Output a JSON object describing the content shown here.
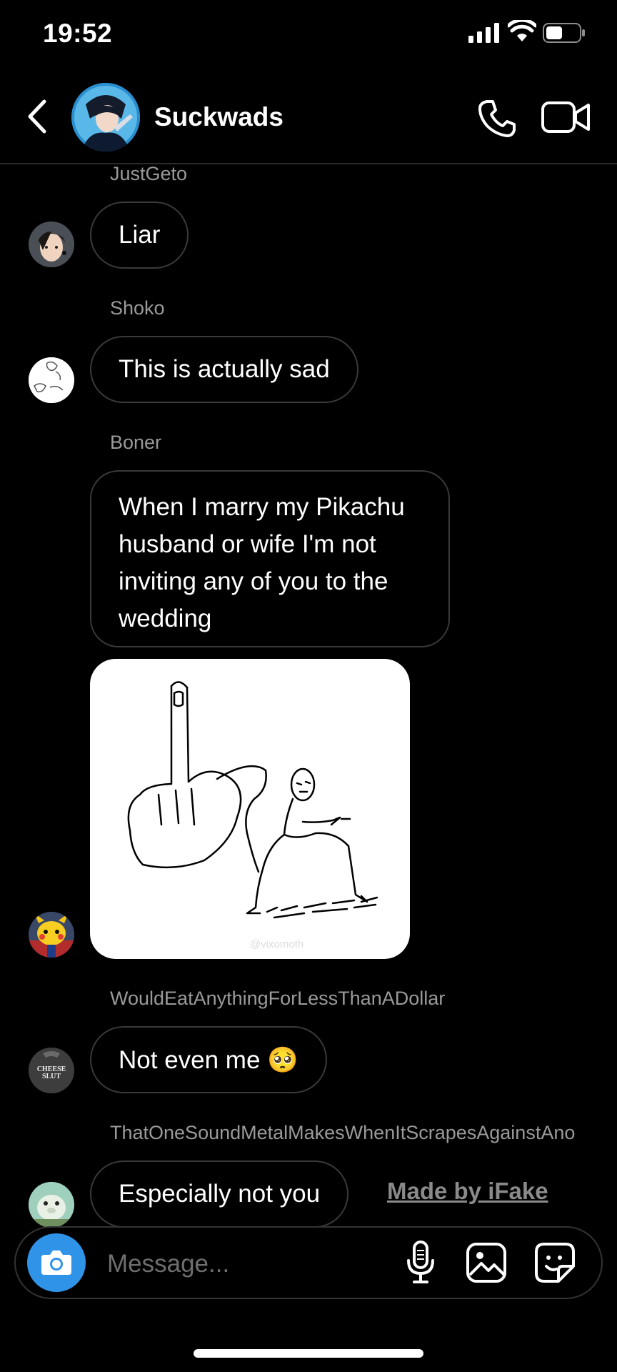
{
  "status_bar": {
    "time": "19:52"
  },
  "header": {
    "group_name": "Suckwads"
  },
  "messages": [
    {
      "sender": "JustGeto",
      "text": "Liar"
    },
    {
      "sender": "Shoko",
      "text": "This is actually sad"
    },
    {
      "sender": "Boner",
      "text": "When I marry my Pikachu husband or wife I'm not inviting any of you to the wedding"
    },
    {
      "sender": "WouldEatAnythingForLessThanADollar",
      "text": "Not even me 🥺"
    },
    {
      "sender": "ThatOneSoundMetalMakesWhenItScrapesAgainstAno",
      "text": "Especially not you"
    }
  ],
  "image_watermark": "@vixomoth",
  "watermark": "Made by iFake",
  "composer": {
    "placeholder": "Message..."
  },
  "avatar_texts": {
    "cheese": "CHEESE SLUT"
  },
  "colors": {
    "background": "#000000",
    "accent": "#2f93e8",
    "bubble_border": "#3a3a3a",
    "sender_text": "#9a9a9a"
  },
  "icons": [
    "back-icon",
    "phone-icon",
    "video-camera-icon",
    "camera-icon",
    "microphone-icon",
    "gallery-icon",
    "sticker-icon"
  ]
}
